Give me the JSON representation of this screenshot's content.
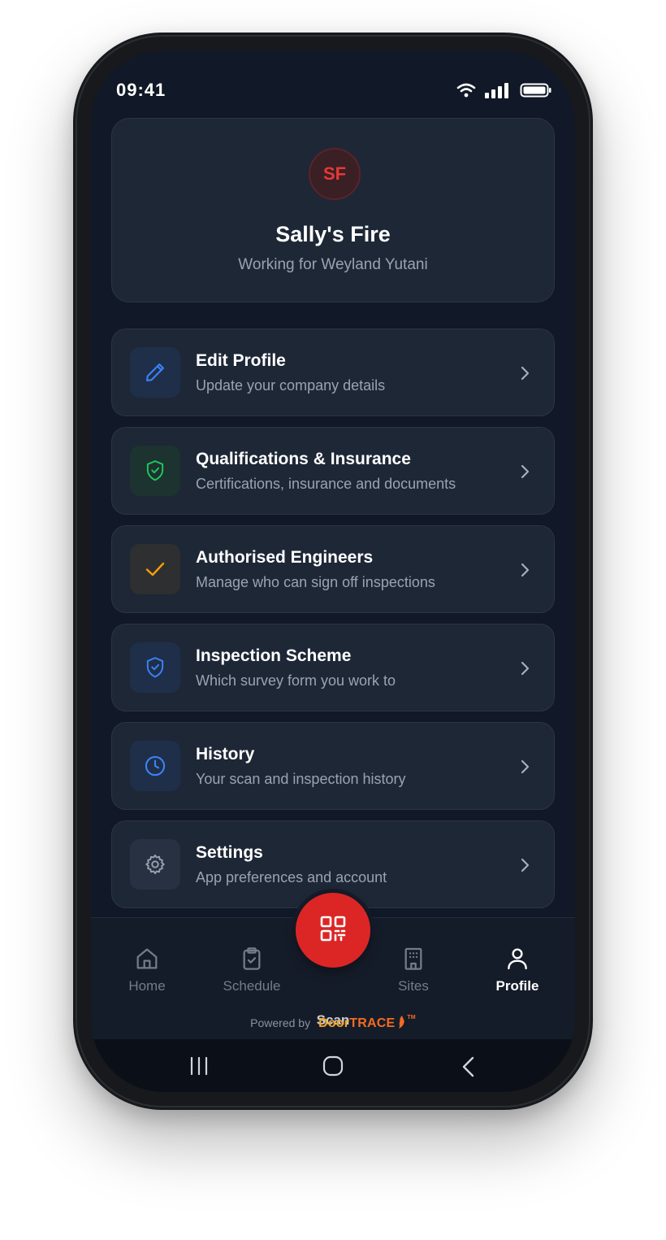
{
  "status_bar": {
    "time": "09:41"
  },
  "profile": {
    "initials": "SF",
    "name": "Sally's Fire",
    "subtitle": "Working for Weyland Yutani"
  },
  "menu": [
    {
      "title": "Edit Profile",
      "subtitle": "Update your company details",
      "icon": "pencil-icon",
      "accent": "#3b82f6"
    },
    {
      "title": "Qualifications & Insurance",
      "subtitle": "Certifications, insurance and documents",
      "icon": "shield-check-icon",
      "accent": "#22c55e"
    },
    {
      "title": "Authorised Engineers",
      "subtitle": "Manage who can sign off inspections",
      "icon": "check-icon",
      "accent": "#f59e0b"
    },
    {
      "title": "Inspection Scheme",
      "subtitle": "Which survey form you work to",
      "icon": "shield-icon",
      "accent": "#3b82f6"
    },
    {
      "title": "History",
      "subtitle": "Your scan and inspection history",
      "icon": "clock-icon",
      "accent": "#3b82f6"
    },
    {
      "title": "Settings",
      "subtitle": "App preferences and account",
      "icon": "gear-icon",
      "accent": "#9ca3af"
    }
  ],
  "tabs": {
    "home": "Home",
    "schedule": "Schedule",
    "scan": "Scan",
    "sites": "Sites",
    "profile": "Profile",
    "active": "profile"
  },
  "footer": {
    "powered_by": "Powered by",
    "brand_part1": "Door",
    "brand_part2": "TRACE",
    "trademark": "TM"
  },
  "colors": {
    "background": "#111827",
    "card": "#1e2736",
    "scan_button": "#dc2626",
    "avatar_text": "#e53935"
  }
}
